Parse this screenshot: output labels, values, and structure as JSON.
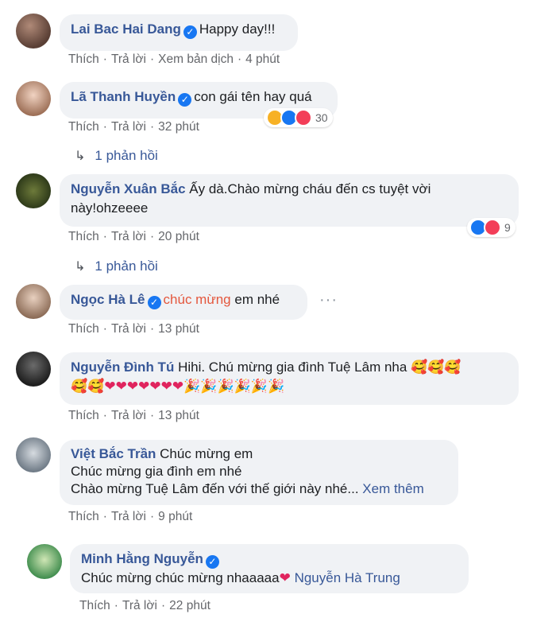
{
  "colors": {
    "author": "#385898",
    "bubble": "#f0f2f5",
    "meta": "#65676b",
    "verified": "#1877f2",
    "highlight": "#e4573d"
  },
  "icons": {
    "verified": "✓",
    "reply_arrow": "↳",
    "more": "···",
    "heart": "❤",
    "party": "🎉",
    "face": "🥰"
  },
  "actions": {
    "like": "Thích",
    "reply": "Trả lời",
    "translate": "Xem bản dịch",
    "dot": "·"
  },
  "comments": [
    {
      "author": "Lai Bac Hai Dang",
      "text": "Happy day!!!",
      "time": "4 phút"
    },
    {
      "author": "Lã Thanh Huyền",
      "text": "con gái tên hay quá",
      "time": "32 phút",
      "reaction_count": "30",
      "replies": "1 phản hồi"
    },
    {
      "author": "Nguyễn Xuân Bắc",
      "text_line1": "Ấy dà.Chào mừng cháu đến cs tuyệt vời",
      "text_line2": "này!ohzeeee",
      "time": "20 phút",
      "reaction_count": "9",
      "replies": "1 phản hồi"
    },
    {
      "author": "Ngọc Hà Lê",
      "text_highlight": "chúc mừng",
      "text": "em nhé",
      "time": "13 phút"
    },
    {
      "author": "Nguyễn Đình Tú",
      "text": "Hihi. Chú mừng gia đình Tuệ Lâm nha",
      "time": "13 phút"
    },
    {
      "author": "Việt Bắc Trần",
      "text_line1": "Chúc mừng em",
      "text_line2": "Chúc mừng gia đình em nhé",
      "text_line3": "Chào mừng Tuệ Lâm đến với thế giới này nhé...",
      "see_more": "Xem thêm",
      "time": "9 phút"
    },
    {
      "author": "Minh Hằng Nguyễn",
      "text": "Chúc mừng chúc mừng nhaaaaa",
      "text_after": "Nguyễn Hà Trung",
      "time": "22 phút"
    }
  ]
}
